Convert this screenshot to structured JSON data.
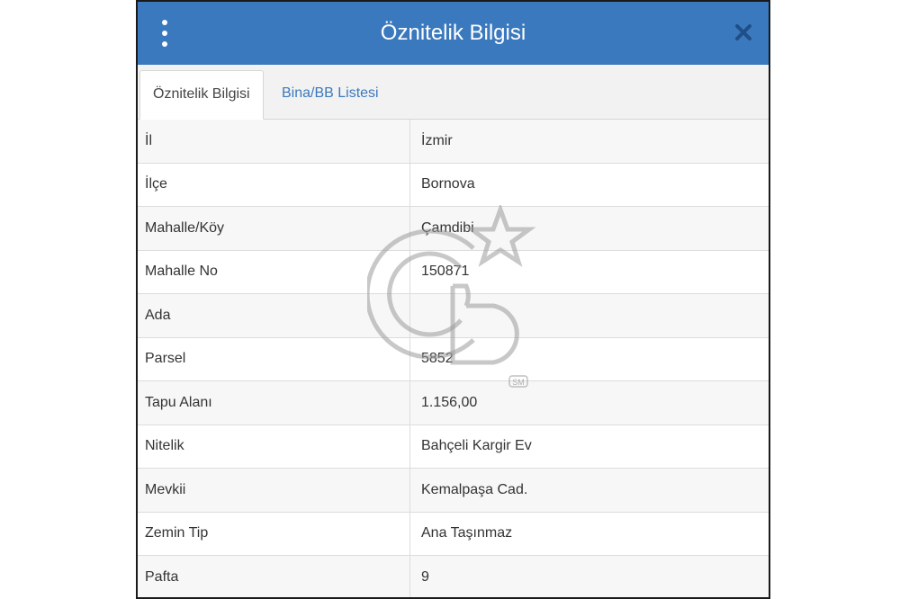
{
  "header": {
    "title": "Öznitelik Bilgisi",
    "background": "#3a79bd",
    "menu_icon": "vertical-ellipsis-icon",
    "close_icon": "close-icon"
  },
  "tabs": [
    {
      "label": "Öznitelik Bilgisi",
      "active": true
    },
    {
      "label": "Bina/BB Listesi",
      "active": false
    }
  ],
  "rows": [
    {
      "label": "İl",
      "value": "İzmir"
    },
    {
      "label": "İlçe",
      "value": "Bornova"
    },
    {
      "label": "Mahalle/Köy",
      "value": "Çamdibi"
    },
    {
      "label": "Mahalle No",
      "value": "150871"
    },
    {
      "label": "Ada",
      "value": ""
    },
    {
      "label": "Parsel",
      "value": "5852"
    },
    {
      "label": "Tapu Alanı",
      "value": "1.156,00"
    },
    {
      "label": "Nitelik",
      "value": "Bahçeli Kargir Ev"
    },
    {
      "label": "Mevkii",
      "value": "Kemalpaşa Cad."
    },
    {
      "label": "Zemin Tip",
      "value": "Ana Taşınmaz"
    },
    {
      "label": "Pafta",
      "value": "9"
    }
  ],
  "watermark": {
    "text": "SM",
    "icon": "cb-star-logo-watermark"
  }
}
